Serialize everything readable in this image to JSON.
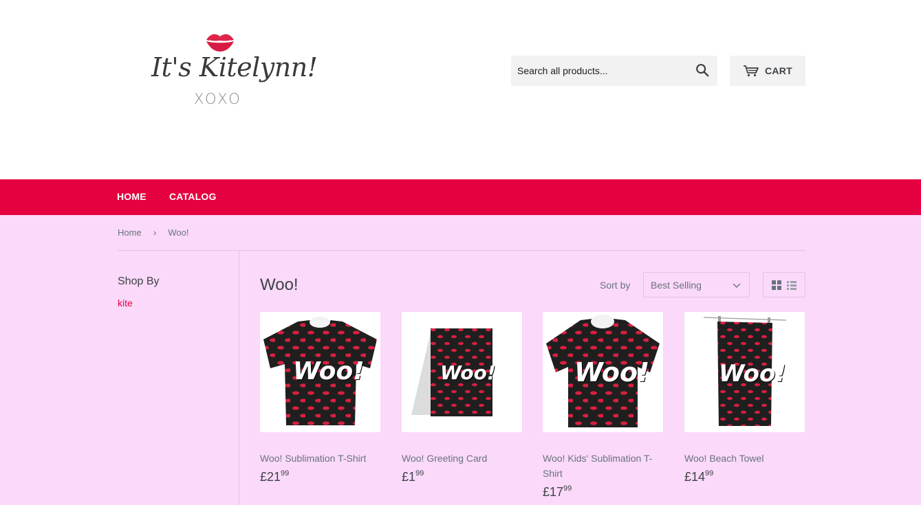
{
  "header": {
    "logo": {
      "script_text": "It's Kitelynn!",
      "sub_text": "XOXO"
    },
    "search": {
      "placeholder": "Search all products...",
      "icon": "search-icon"
    },
    "cart": {
      "label": "CART",
      "icon": "cart-icon"
    }
  },
  "nav": {
    "items": [
      {
        "label": "HOME"
      },
      {
        "label": "CATALOG"
      }
    ],
    "background": "#e5003f"
  },
  "breadcrumb": {
    "home": "Home",
    "separator": "›",
    "current": "Woo!"
  },
  "sidebar": {
    "heading": "Shop By",
    "filters": [
      "kite"
    ]
  },
  "collection": {
    "title": "Woo!",
    "sort_label": "Sort by",
    "sort_value": "Best Selling",
    "view_icons": [
      "grid-view-icon",
      "list-view-icon"
    ]
  },
  "products": [
    {
      "name": "Woo! Sublimation T-Shirt",
      "currency": "£",
      "price_main": "21",
      "price_cents": "99",
      "image_text": "Woo!"
    },
    {
      "name": "Woo! Greeting Card",
      "currency": "£",
      "price_main": "1",
      "price_cents": "99",
      "image_text": "Woo!"
    },
    {
      "name": "Woo! Kids' Sublimation T-Shirt",
      "currency": "£",
      "price_main": "17",
      "price_cents": "99",
      "image_text": "Woo!"
    },
    {
      "name": "Woo! Beach Towel",
      "currency": "£",
      "price_main": "14",
      "price_cents": "99",
      "image_text": "Woo!"
    }
  ],
  "colors": {
    "accent": "#e5003f",
    "page_bg": "#fad9fa",
    "header_bg": "#ffffff",
    "input_bg": "#f2f2f2"
  }
}
